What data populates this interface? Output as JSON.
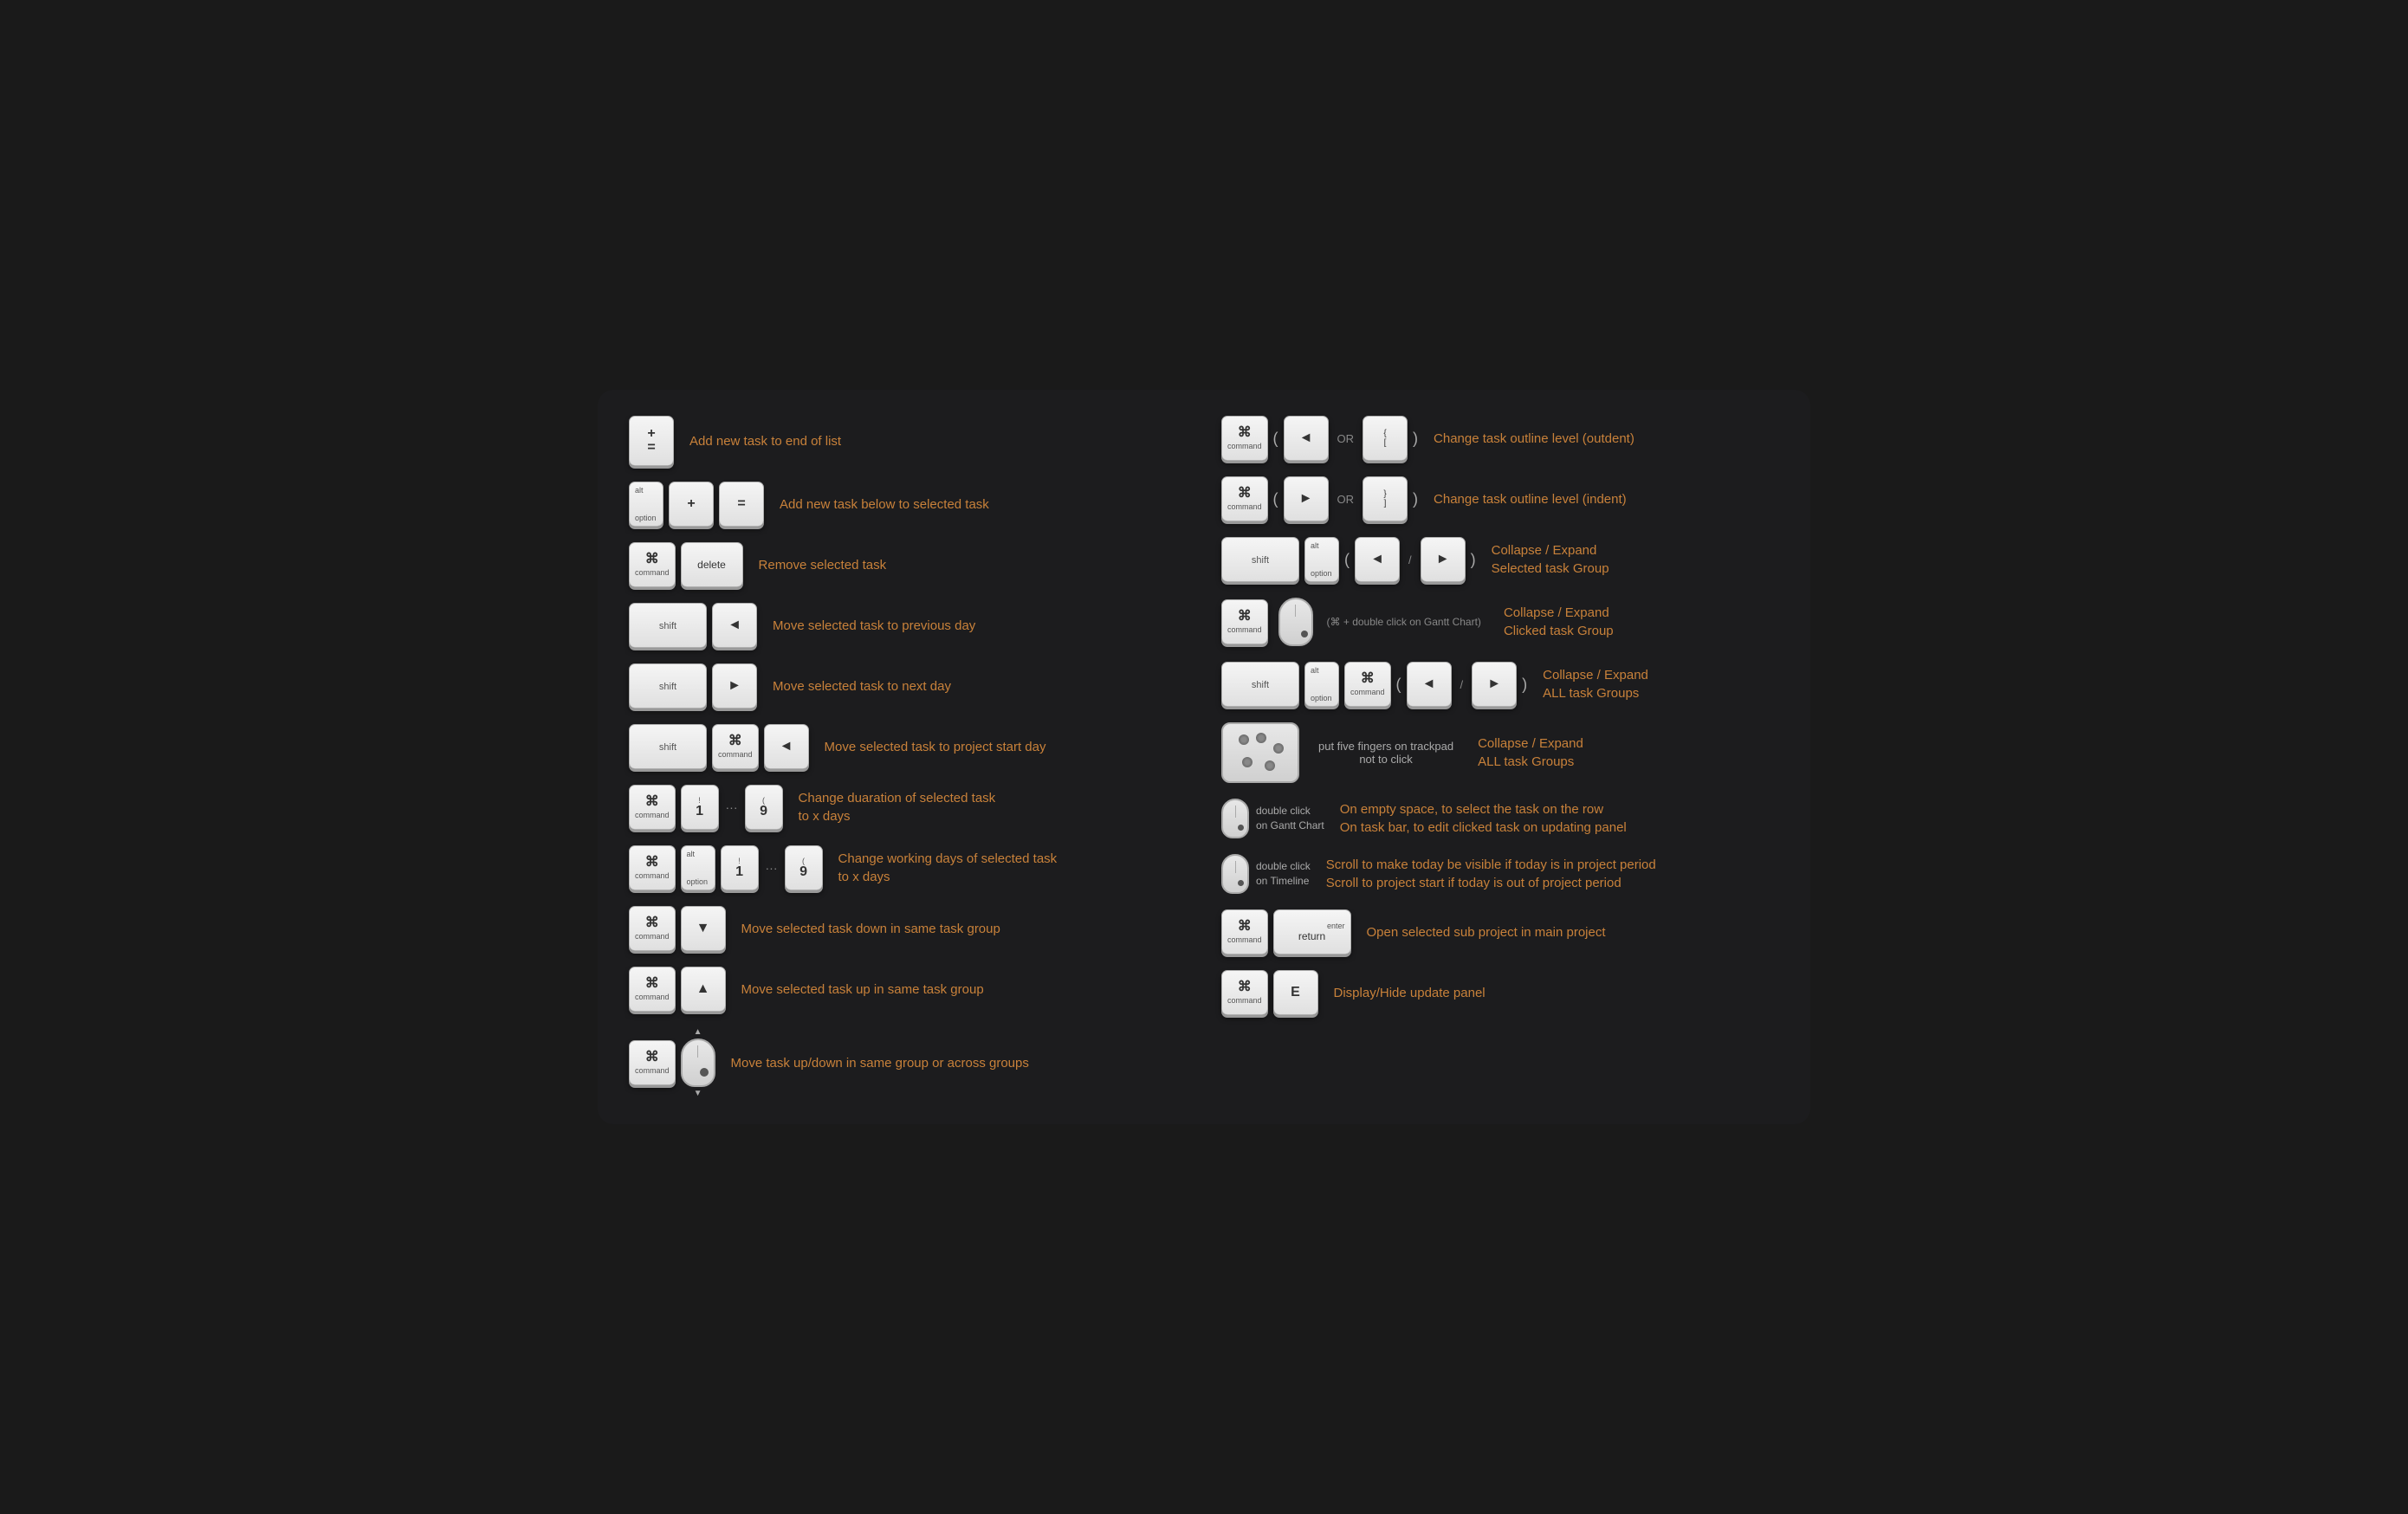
{
  "shortcuts": {
    "left": [
      {
        "id": "add-end",
        "keys": [
          {
            "symbol": "+",
            "label": ""
          },
          {
            "symbol": "=",
            "label": ""
          }
        ],
        "stacked": true,
        "description": "Add new task to end of list"
      },
      {
        "id": "add-below",
        "keys": [
          {
            "symbol": "+",
            "top": "alt",
            "bottom": "option"
          },
          {
            "symbol": "+",
            "label": ""
          },
          {
            "symbol": "=",
            "label": ""
          }
        ],
        "description": "Add new task below to selected task"
      },
      {
        "id": "remove",
        "keys": [
          {
            "symbol": "⌘",
            "label": "command"
          },
          {
            "symbol": "delete",
            "label": ""
          }
        ],
        "description": "Remove selected task"
      },
      {
        "id": "prev-day",
        "keys": [
          {
            "symbol": "",
            "label": "shift",
            "wide": true
          },
          {
            "symbol": "◄",
            "label": ""
          }
        ],
        "description": "Move selected task to previous day"
      },
      {
        "id": "next-day",
        "keys": [
          {
            "symbol": "",
            "label": "shift",
            "wide": true
          },
          {
            "symbol": "►",
            "label": ""
          }
        ],
        "description": "Move selected task to next day"
      },
      {
        "id": "project-start",
        "keys": [
          {
            "symbol": "",
            "label": "shift",
            "wide": true
          },
          {
            "symbol": "⌘",
            "label": "command"
          },
          {
            "symbol": "◄",
            "label": ""
          }
        ],
        "description": "Move selected task to project start day"
      },
      {
        "id": "duration",
        "keys": [
          {
            "symbol": "⌘",
            "label": "command"
          },
          {
            "symbol": "!",
            "sub": "1"
          },
          {
            "symbol": "...",
            "plain": true
          },
          {
            "symbol": "(",
            "sub": "9"
          }
        ],
        "description": "Change duaration of selected task\nto x days"
      },
      {
        "id": "working-days",
        "keys": [
          {
            "symbol": "⌘",
            "label": "command"
          },
          {
            "symbol": "alt\noption"
          },
          {
            "symbol": "!",
            "sub": "1"
          },
          {
            "symbol": "...",
            "plain": true
          },
          {
            "symbol": "(",
            "sub": "9"
          }
        ],
        "description": "Change working days of selected task\nto x days"
      },
      {
        "id": "move-down",
        "keys": [
          {
            "symbol": "⌘",
            "label": "command"
          },
          {
            "symbol": "▼",
            "label": ""
          }
        ],
        "description": "Move selected task down in same task group"
      },
      {
        "id": "move-up",
        "keys": [
          {
            "symbol": "⌘",
            "label": "command"
          },
          {
            "symbol": "▲",
            "label": ""
          }
        ],
        "description": "Move selected task up in same task group"
      },
      {
        "id": "move-updown-mouse",
        "keys": [
          {
            "symbol": "⌘",
            "label": "command"
          }
        ],
        "hasMouse": true,
        "description": "Move task up/down in same group or across groups"
      }
    ],
    "right": [
      {
        "id": "outdent",
        "keys": [
          {
            "symbol": "⌘",
            "label": "command"
          }
        ],
        "extraKeys": [
          {
            "symbol": "◄"
          },
          {
            "text": "OR"
          },
          {
            "symbol": "{"
          },
          {
            "symbol": "["
          }
        ],
        "description": "Change task outline level (outdent)"
      },
      {
        "id": "indent",
        "keys": [
          {
            "symbol": "⌘",
            "label": "command"
          }
        ],
        "extraKeys": [
          {
            "symbol": "►"
          },
          {
            "text": "OR"
          },
          {
            "symbol": "}"
          },
          {
            "symbol": "]"
          }
        ],
        "description": "Change task outline level (indent)"
      },
      {
        "id": "collapse-selected",
        "keys": [
          {
            "symbol": "",
            "label": "shift",
            "wide": true
          },
          {
            "symbol": "alt",
            "sub": "option"
          }
        ],
        "extraKeys": [
          {
            "symbol": "◄"
          },
          {
            "text": "/"
          },
          {
            "symbol": "►"
          }
        ],
        "description": "Collapse / Expand\nSelected task Group"
      },
      {
        "id": "collapse-clicked",
        "keys": [
          {
            "symbol": "⌘",
            "label": "command"
          }
        ],
        "hasMiniMouse": true,
        "extraText": "(⌘ + double click on Gantt Chart)",
        "description": "Collapse / Expand\nClicked task Group"
      },
      {
        "id": "collapse-all",
        "keys": [
          {
            "symbol": "",
            "label": "shift",
            "wide": true
          },
          {
            "symbol": "alt\noption"
          },
          {
            "symbol": "⌘",
            "label": "command"
          }
        ],
        "extraKeys": [
          {
            "symbol": "◄"
          },
          {
            "text": "/"
          },
          {
            "symbol": "►"
          }
        ],
        "description": "Collapse / Expand\nALL task Groups"
      },
      {
        "id": "trackpad-five",
        "hasTrackpad": true,
        "extraText": "put five fingers on trackpad\nnot to click",
        "description": "Collapse / Expand\nALL task Groups"
      },
      {
        "id": "double-click-gantt",
        "hasSmallMouse": true,
        "mouseLabel": "double click\non Gantt Chart",
        "description": "On empty space, to select the task on the row\nOn task bar,  to edit clicked task on updating panel"
      },
      {
        "id": "double-click-timeline",
        "hasSmallMouse2": true,
        "mouseLabel": "double click\non Timeline",
        "description": "Scroll to make today be visible if today is in project period\nScroll to project start if today is out of project period"
      },
      {
        "id": "open-sub",
        "keys": [
          {
            "symbol": "⌘",
            "label": "command"
          },
          {
            "symbol": "enter\nreturn",
            "wide": true
          }
        ],
        "description": "Open selected sub project in main project"
      },
      {
        "id": "display-hide",
        "keys": [
          {
            "symbol": "⌘",
            "label": "command"
          },
          {
            "symbol": "E",
            "label": ""
          }
        ],
        "description": "Display/Hide update panel"
      }
    ]
  }
}
